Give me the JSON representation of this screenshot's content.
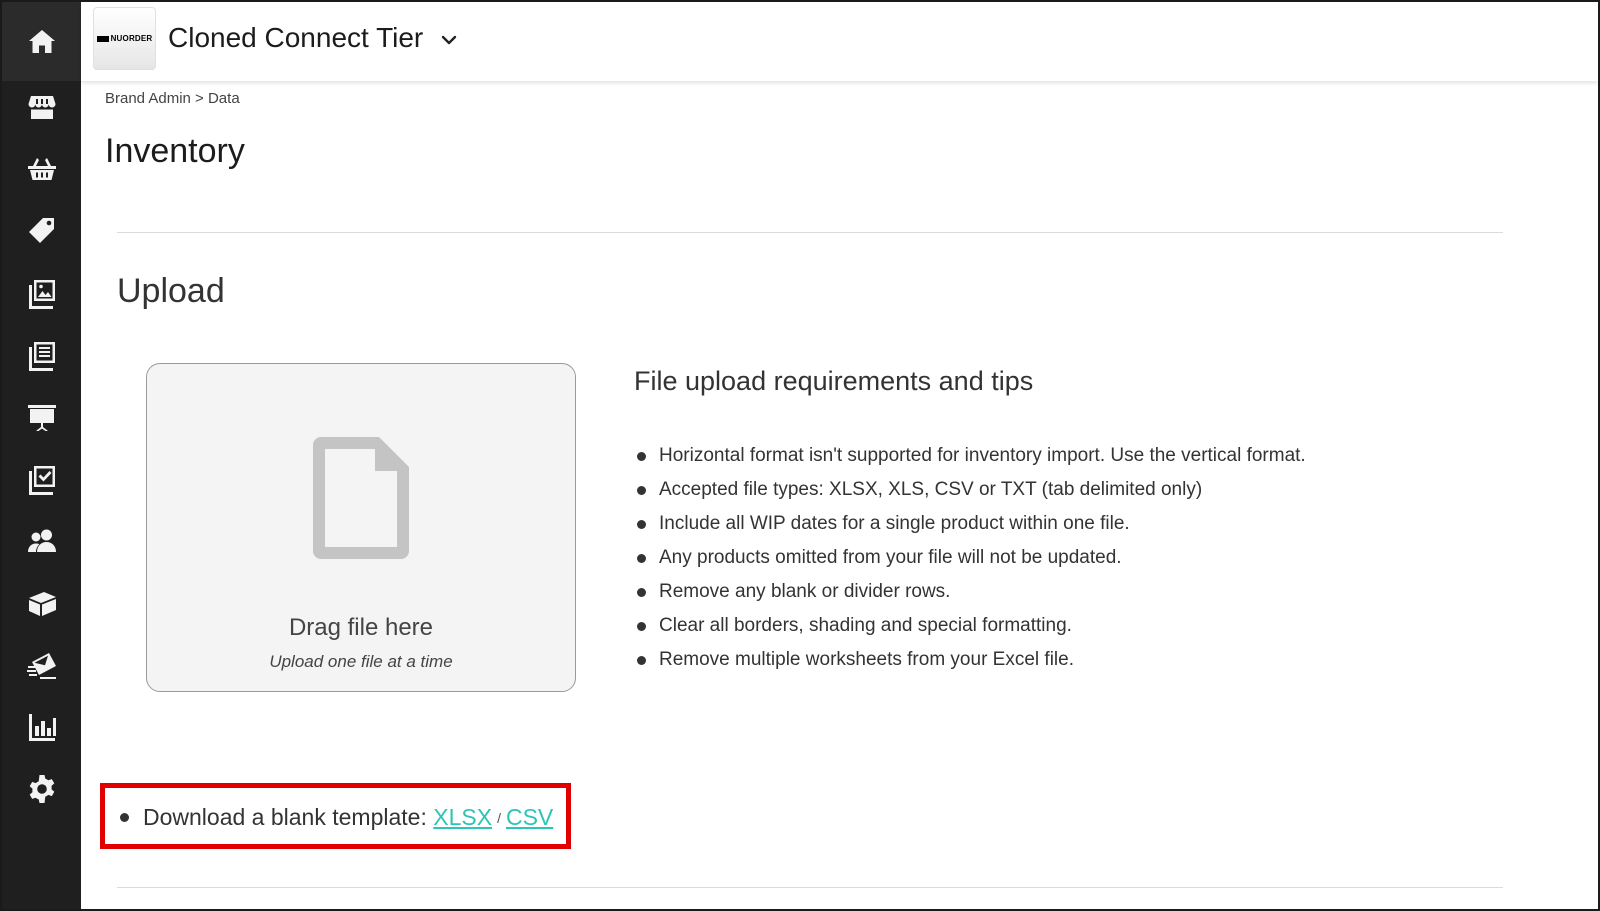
{
  "header": {
    "logo_text": "NUORDER",
    "title": "Cloned Connect Tier"
  },
  "sidebar": {
    "items": [
      {
        "name": "home-icon"
      },
      {
        "name": "storefront-icon"
      },
      {
        "name": "basket-icon"
      },
      {
        "name": "tag-icon"
      },
      {
        "name": "image-gallery-icon"
      },
      {
        "name": "catalog-icon"
      },
      {
        "name": "presentation-icon"
      },
      {
        "name": "checklist-icon"
      },
      {
        "name": "users-icon"
      },
      {
        "name": "package-icon"
      },
      {
        "name": "email-icon"
      },
      {
        "name": "bar-chart-icon"
      },
      {
        "name": "gear-icon"
      }
    ]
  },
  "breadcrumb": "Brand Admin > Data",
  "page_title": "Inventory",
  "upload": {
    "section_title": "Upload",
    "dropzone_title": "Drag file here",
    "dropzone_subtitle": "Upload one file at a time",
    "tips_title": "File upload requirements and tips",
    "tips": [
      "Horizontal format isn't supported for inventory import. Use the vertical format.",
      "Accepted file types: XLSX, XLS, CSV or TXT (tab delimited only)",
      "Include all WIP dates for a single product within one file.",
      "Any products omitted from your file will not be updated.",
      "Remove any blank or divider rows.",
      "Clear all borders, shading and special formatting.",
      "Remove multiple worksheets from your Excel file."
    ]
  },
  "template": {
    "label": "Download a blank template:",
    "xlsx_link": "XLSX",
    "separator": "/",
    "csv_link": "CSV"
  },
  "colors": {
    "sidebar_bg": "#1f1f1f",
    "link": "#2ec4b6",
    "highlight_border": "#e00000"
  }
}
